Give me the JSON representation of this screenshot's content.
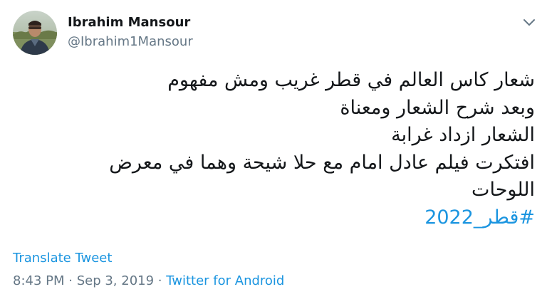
{
  "user": {
    "name": "Ibrahim Mansour",
    "handle": "@Ibrahim1Mansour",
    "avatar_icon": "profile-photo"
  },
  "menu_icon": "chevron-down-icon",
  "tweet": {
    "lines": [
      "شعار كاس العالم في قطر غريب ومش مفهوم",
      "وبعد شرح الشعار ومعناة",
      "الشعار ازداد غرابة",
      "افتكرت فيلم عادل امام مع حلا شيحة وهما في معرض",
      "اللوحات"
    ],
    "hashtag": "#قطر_2022"
  },
  "translate_label": "Translate Tweet",
  "meta": {
    "time": "8:43 PM",
    "separator": " · ",
    "date": "Sep 3, 2019",
    "source": "Twitter for Android"
  },
  "colors": {
    "link": "#1b95e0",
    "secondary_text": "#657786",
    "primary_text": "#14171a"
  }
}
